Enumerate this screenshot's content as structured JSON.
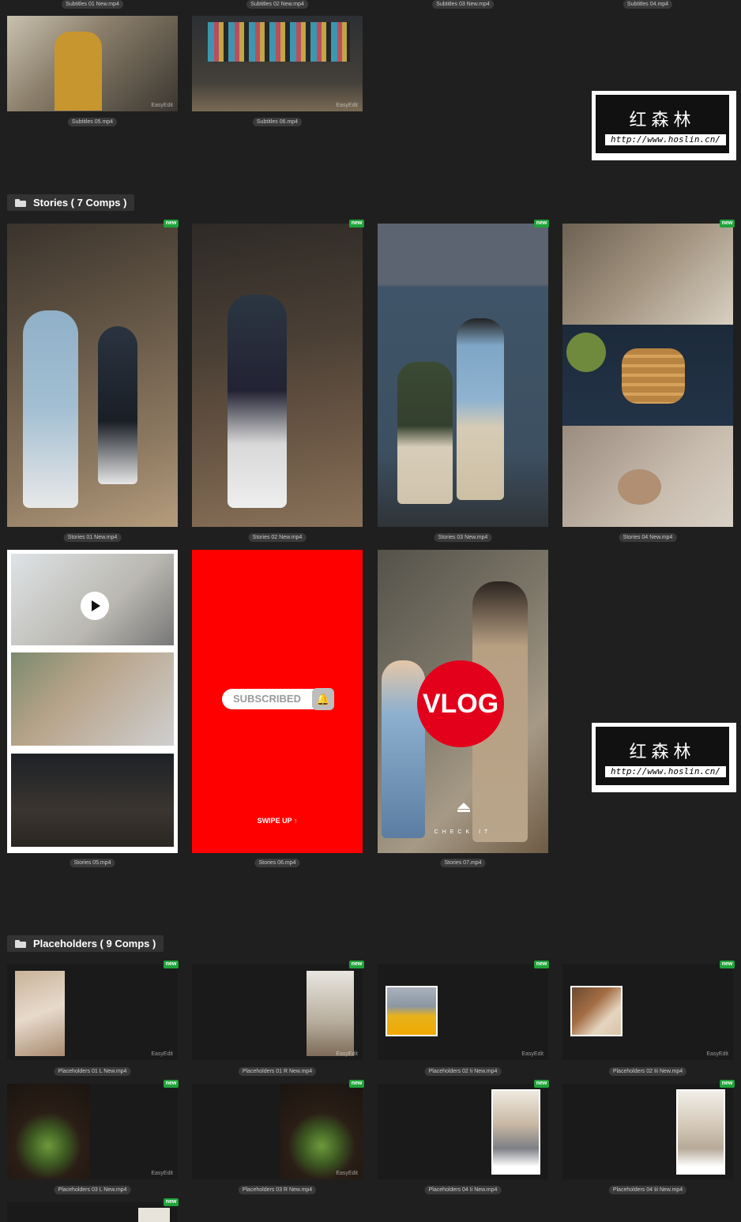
{
  "top_captions": [
    "Subtitles 01 New.mp4",
    "Subtitles 02 New.mp4",
    "Subtitles 03 New.mp4",
    "Subtitles 04.mp4"
  ],
  "subtitles_row": [
    {
      "caption": "Subtitles 05.mp4",
      "watermark": "EasyEdit"
    },
    {
      "caption": "Subtitles 06.mp4",
      "watermark": "EasyEdit"
    }
  ],
  "watermark": {
    "title": "红森林",
    "url": "http://www.hoslin.cn/"
  },
  "stories_section": {
    "title": "Stories ( 7 Comps )"
  },
  "stories": [
    {
      "caption": "Stories 01 New.mp4",
      "badge": "new"
    },
    {
      "caption": "Stories 02 New.mp4",
      "badge": "new"
    },
    {
      "caption": "Stories 03 New.mp4",
      "badge": "new"
    },
    {
      "caption": "Stories 04 New.mp4",
      "badge": "new"
    },
    {
      "caption": "Stories 05.mp4"
    },
    {
      "caption": "Stories 06.mp4",
      "subscribed": "SUBSCRIBED",
      "swipe": "SWIPE UP ↑"
    },
    {
      "caption": "Stories 07.mp4",
      "vlog": "VLOG",
      "check": "CHECK IT"
    }
  ],
  "placeholders_section": {
    "title": "Placeholders ( 9 Comps )"
  },
  "placeholders": [
    {
      "caption": "Placeholders 01 L New.mp4",
      "badge": "new",
      "watermark": "EasyEdit"
    },
    {
      "caption": "Placeholders 01 R New.mp4",
      "badge": "new",
      "watermark": "EasyEdit"
    },
    {
      "caption": "Placeholders 02 Ii New.mp4",
      "badge": "new",
      "watermark": "EasyEdit"
    },
    {
      "caption": "Placeholders 02 Iii New.mp4",
      "badge": "new",
      "watermark": "EasyEdit"
    },
    {
      "caption": "Placeholders 03 L New.mp4",
      "badge": "new",
      "watermark": "EasyEdit"
    },
    {
      "caption": "Placeholders 03 R New.mp4",
      "badge": "new",
      "watermark": "EasyEdit"
    },
    {
      "caption": "Placeholders 04 Ii New.mp4",
      "badge": "new"
    },
    {
      "caption": "Placeholders 04 Iii New.mp4",
      "badge": "new"
    },
    {
      "badge": "new"
    }
  ],
  "colors": {
    "background": "#1f1f1f",
    "badge": "#1fa33a",
    "accent_red": "#ff0000"
  }
}
